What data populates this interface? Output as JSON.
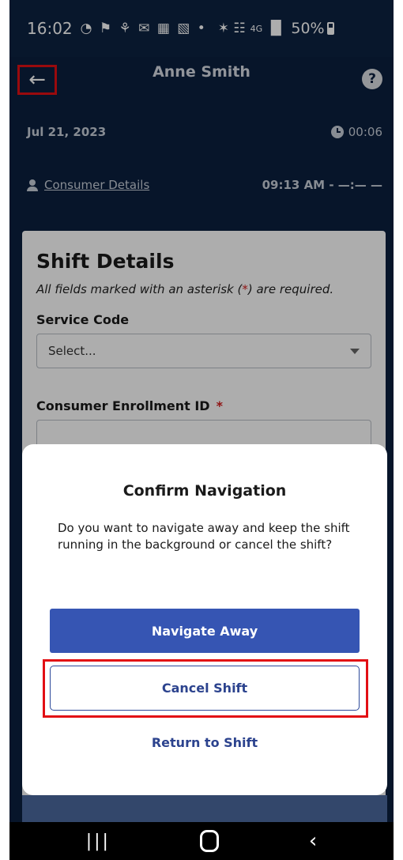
{
  "status_bar": {
    "time": "16:02",
    "notification_icons": "⧃ ⛭ ⚘ ✉ ▦ ▧ •",
    "connectivity_icons": "⧉ ☴ ὏6",
    "network_label": "4G",
    "battery": "50%"
  },
  "header": {
    "back_icon": "←",
    "title": "Anne Smith",
    "help_icon": "?",
    "date": "Jul 21, 2023",
    "elapsed": "00:06",
    "consumer_link": "Consumer Details",
    "time_range": "09:13 AM - —:— —"
  },
  "card": {
    "title": "Shift Details",
    "note_prefix": "All fields marked with an asterisk (",
    "note_star": "*",
    "note_suffix": ") are required.",
    "service_code_label": "Service Code",
    "service_code_value": "Select...",
    "enrollment_label": "Consumer Enrollment ID",
    "required_mark": "*"
  },
  "modal": {
    "title": "Confirm Navigation",
    "body": "Do you want to navigate away and keep the shift running in the background or cancel the shift?",
    "primary_button": "Navigate Away",
    "secondary_button": "Cancel Shift",
    "link_button": "Return to Shift"
  },
  "navbar": {
    "recents": "|||",
    "back": "‹"
  },
  "colors": {
    "header_bg": "#0b1f3e",
    "primary": "#3655b3",
    "highlight": "#e20f14",
    "required": "#d41e1e"
  }
}
